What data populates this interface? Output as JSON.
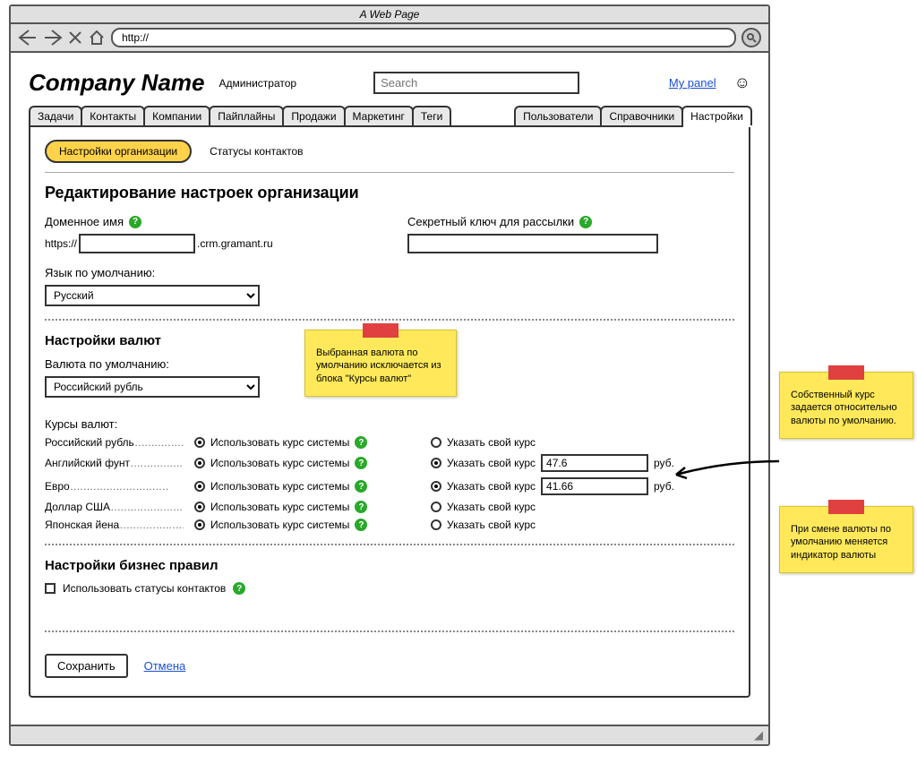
{
  "browser": {
    "title": "A Web Page",
    "url_prefix": "http://"
  },
  "header": {
    "company": "Company Name",
    "role": "Администратор",
    "search_placeholder": "Search",
    "my_panel": "My panel"
  },
  "tabs_left": [
    "Задачи",
    "Контакты",
    "Компании",
    "Пайплайны",
    "Продажи",
    "Маркетинг",
    "Теги"
  ],
  "tabs_right": [
    "Пользователи",
    "Справочники",
    "Настройки"
  ],
  "active_tab_right_index": 2,
  "subtabs": {
    "active": "Настройки организации",
    "other": "Статусы контактов"
  },
  "page_title": "Редактирование настроек организации",
  "domain": {
    "label": "Доменное имя",
    "prefix": "https://",
    "suffix": ".crm.gramant.ru",
    "value": ""
  },
  "secret": {
    "label": "Секретный ключ для рассылки",
    "value": ""
  },
  "lang": {
    "label": "Язык по умолчанию:",
    "value": "Русский"
  },
  "currency": {
    "section_title": "Настройки валют",
    "default_label": "Валюта по умолчанию:",
    "default_value": "Российский рубль",
    "rates_label": "Курсы валют:",
    "opt_system": "Использовать курс системы",
    "opt_own": "Указать свой курс",
    "unit": "руб.",
    "rows": [
      {
        "name": "Российский рубль",
        "mode": "system",
        "own_value": ""
      },
      {
        "name": "Английский фунт",
        "mode": "own",
        "own_value": "47.6"
      },
      {
        "name": "Евро",
        "mode": "own",
        "own_value": "41.66"
      },
      {
        "name": "Доллар США",
        "mode": "system",
        "own_value": ""
      },
      {
        "name": "Японская йена",
        "mode": "system",
        "own_value": ""
      }
    ]
  },
  "biz": {
    "section_title": "Настройки бизнес правил",
    "chk_label": "Использовать статусы контактов",
    "chk_value": false
  },
  "actions": {
    "save": "Сохранить",
    "cancel": "Отмена"
  },
  "notes": {
    "n1": "Выбранная валюта по умолчанию исключается из блока \"Курсы валют\"",
    "n2": "Собственный курс задается относительно валюты по умолчанию.",
    "n3": "При смене валюты по умолчанию меняется индикатор валюты"
  }
}
